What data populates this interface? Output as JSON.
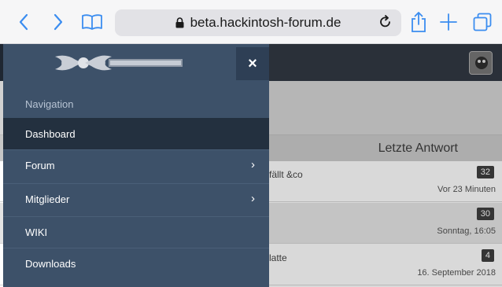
{
  "browser": {
    "url": "beta.hackintosh-forum.de",
    "back_icon": "chevron-left-icon",
    "forward_icon": "chevron-right-icon",
    "bookmarks_icon": "book-icon",
    "share_icon": "share-icon",
    "new_tab_icon": "plus-icon",
    "tabs_icon": "tabs-icon",
    "reload_icon": "reload-icon",
    "lock_icon": "lock-icon",
    "accent_color": "#3b8df0"
  },
  "page": {
    "column_header": "Letzte Antwort",
    "rows": [
      {
        "title": "fällt &co",
        "count": "32",
        "time": "Vor 23 Minuten"
      },
      {
        "title": "",
        "count": "30",
        "time": "Sonntag, 16:05"
      },
      {
        "title": "latte",
        "count": "4",
        "time": "16. September 2018"
      }
    ]
  },
  "menu": {
    "close_label": "×",
    "items": [
      {
        "label": "Navigation",
        "type": "heading"
      },
      {
        "label": "Dashboard",
        "type": "active"
      },
      {
        "label": "Forum",
        "type": "submenu"
      },
      {
        "label": "Mitglieder",
        "type": "submenu"
      },
      {
        "label": "WIKI",
        "type": "link"
      },
      {
        "label": "Downloads",
        "type": "link"
      }
    ],
    "chevron": "›",
    "bg_color": "#3d5169",
    "active_color": "#23303f"
  }
}
